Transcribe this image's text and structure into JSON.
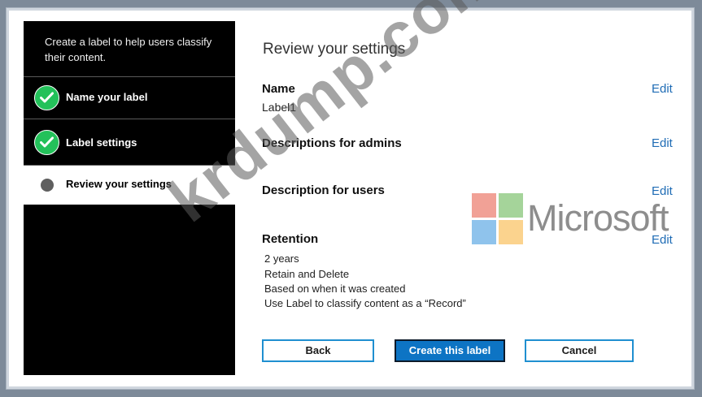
{
  "sidebar": {
    "intro": "Create a label to help users classify their content.",
    "steps": [
      {
        "label": "Name your label",
        "status": "complete"
      },
      {
        "label": "Label settings",
        "status": "complete"
      },
      {
        "label": "Review your settings",
        "status": "current"
      }
    ]
  },
  "main": {
    "title": "Review your settings",
    "sections": [
      {
        "heading": "Name",
        "value": "Label1",
        "edit": "Edit"
      },
      {
        "heading": "Descriptions for admins",
        "edit": "Edit"
      },
      {
        "heading": "Description for users",
        "edit": "Edit"
      },
      {
        "heading": "Retention",
        "edit": "Edit",
        "lines": [
          "2 years",
          "Retain and Delete",
          "Based on when it was created",
          "Use Label to classify content as a “Record”"
        ]
      }
    ]
  },
  "buttons": {
    "back": "Back",
    "create": "Create this label",
    "cancel": "Cancel"
  },
  "overlay": {
    "logo_word": "Microsoft",
    "watermark": "krdump.com"
  },
  "colors": {
    "accent": "#1f6cb5",
    "check": "#23c15a",
    "primary_button": "#0d74c4"
  }
}
